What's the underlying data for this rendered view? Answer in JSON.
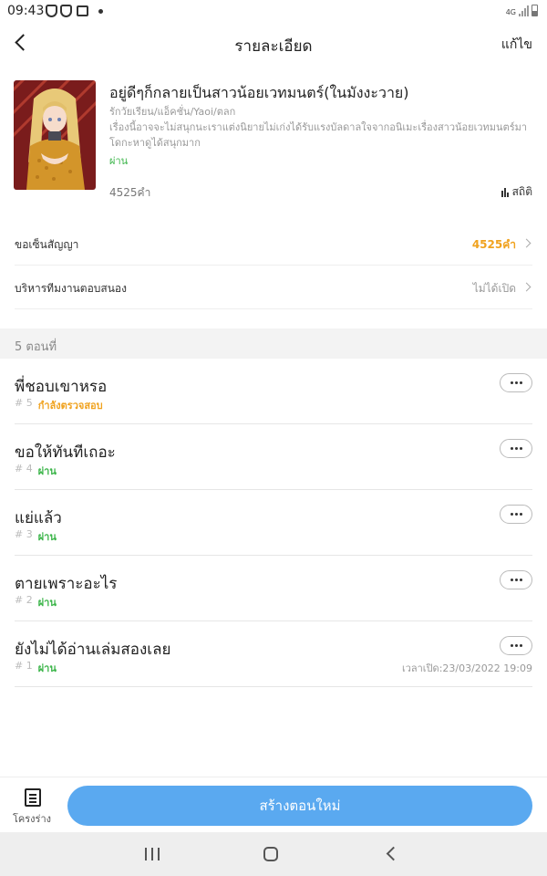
{
  "status_bar": {
    "time": "09:43",
    "network": "4G"
  },
  "header": {
    "title": "รายละเอียด",
    "edit_label": "แก้ไข"
  },
  "novel": {
    "title": "อยู่ดีๆก็กลายเป็นสาวน้อยเวทมนตร์(ในมังงะวาย)",
    "genre": "รักวัยเรียน/แอ็คชั่น/Yaoi/ตลก",
    "description": "เรื่องนี้อาจจะไม่สนุกนะเราแต่งนิยายไม่เก่งได้รับแรงบัลดาลใจจากอนิเมะเรื่องสาวน้อยเวทมนตร์มาโดกะหาดูได้สนุกมาก",
    "status": "ผ่าน",
    "word_count": "4525คำ",
    "stats_label": "สถิติ"
  },
  "settings": [
    {
      "label": "ขอเซ็นสัญญา",
      "value": "4525คำ",
      "highlight": true
    },
    {
      "label": "บริหารทีมงานตอบสนอง",
      "value": "ไม่ได้เปิด",
      "highlight": false
    }
  ],
  "chapters_header": "5 ตอนที่",
  "chapters": [
    {
      "title": "พี่ชอบเขาหรอ",
      "number": "# 5",
      "status": "กำลังตรวจสอบ",
      "pending": true,
      "time": ""
    },
    {
      "title": "ขอให้ทันทีเถอะ",
      "number": "# 4",
      "status": "ผ่าน",
      "pending": false,
      "time": ""
    },
    {
      "title": "แย่แล้ว",
      "number": "# 3",
      "status": "ผ่าน",
      "pending": false,
      "time": ""
    },
    {
      "title": "ตายเพราะอะไร",
      "number": "# 2",
      "status": "ผ่าน",
      "pending": false,
      "time": ""
    },
    {
      "title": "ยังไม่ได้อ่านเล่มสองเลย",
      "number": "# 1",
      "status": "ผ่าน",
      "pending": false,
      "time": "เวลาเปิด:23/03/2022 19:09"
    }
  ],
  "bottom": {
    "draft_label": "โครงร่าง",
    "create_label": "สร้างตอนใหม่"
  },
  "colors": {
    "accent_blue": "#5aa9f0",
    "pass_green": "#3cb54a",
    "pending_orange": "#f0a21e"
  },
  "icons": [
    "shield-icon",
    "gallery-icon",
    "signal-icon",
    "battery-icon",
    "back-arrow-icon",
    "bar-chart-icon",
    "chevron-right-icon",
    "more-dots-icon",
    "draft-document-icon",
    "recents-icon",
    "home-icon",
    "nav-back-icon"
  ]
}
